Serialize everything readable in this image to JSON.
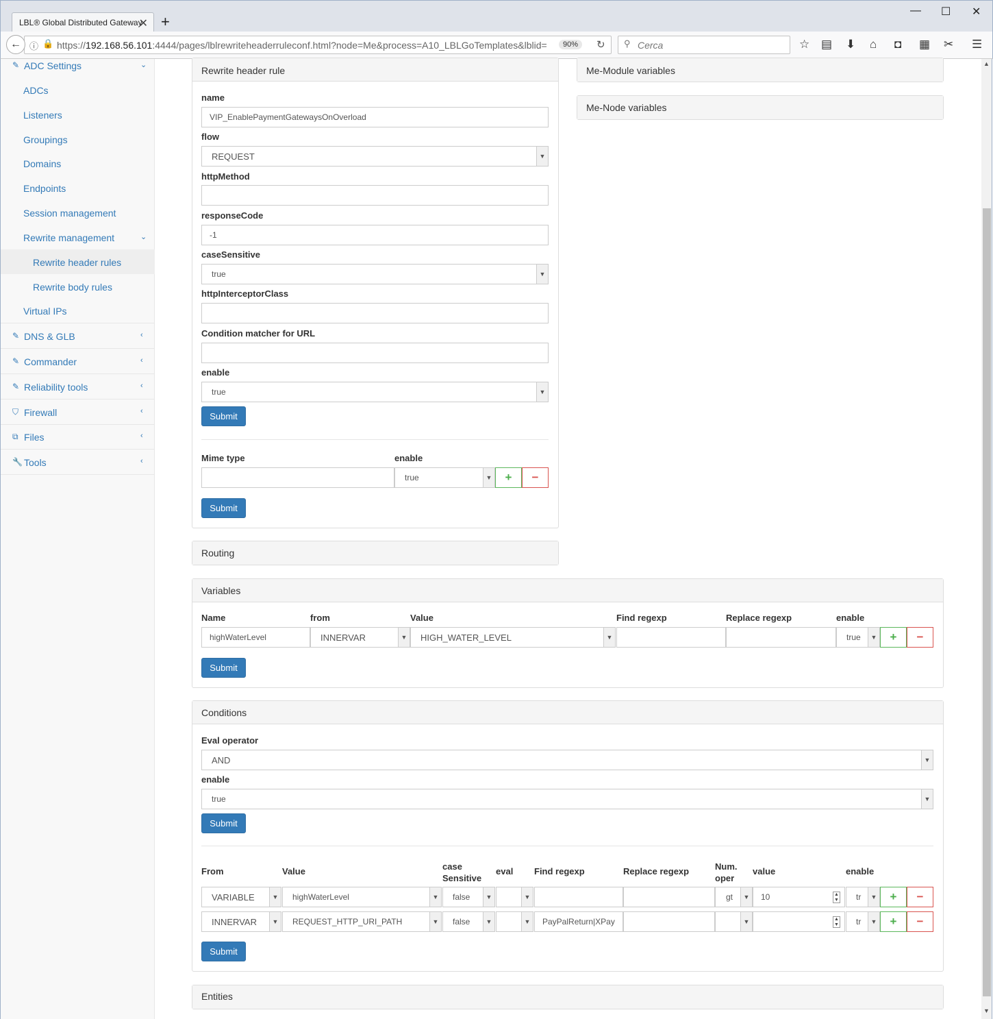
{
  "browser": {
    "tab_title": "LBL® Global Distributed Gateway",
    "url_prefix": "https://",
    "url_host": "192.168.56.101",
    "url_rest": ":4444/pages/lblrewriteheaderruleconf.html?node=Me&process=A10_LBLGoTemplates&lblid=",
    "zoom": "90%",
    "search_placeholder": "Cerca"
  },
  "sidebar": {
    "adc_settings": "ADC Settings",
    "items": [
      "ADCs",
      "Listeners",
      "Groupings",
      "Domains",
      "Endpoints",
      "Session management",
      "Rewrite management"
    ],
    "sub_items": [
      "Rewrite header rules",
      "Rewrite body rules"
    ],
    "virtual_ips": "Virtual IPs",
    "groups": [
      "DNS & GLB",
      "Commander",
      "Reliability tools",
      "Firewall",
      "Files",
      "Tools"
    ]
  },
  "rewrite_panel": {
    "title": "Rewrite header rule",
    "fields": {
      "name_label": "name",
      "name_value": "VIP_EnablePaymentGatewaysOnOverload",
      "flow_label": "flow",
      "flow_value": "REQUEST",
      "httpMethod_label": "httpMethod",
      "httpMethod_value": "",
      "responseCode_label": "responseCode",
      "responseCode_value": "-1",
      "caseSensitive_label": "caseSensitive",
      "caseSensitive_value": "true",
      "httpInterceptorClass_label": "httpInterceptorClass",
      "httpInterceptorClass_value": "",
      "condition_url_label": "Condition matcher for URL",
      "condition_url_value": "",
      "enable_label": "enable",
      "enable_value": "true"
    },
    "submit": "Submit",
    "mime": {
      "mime_label": "Mime type",
      "enable_label": "enable",
      "mime_value": "",
      "enable_value": "true",
      "plus": "+",
      "minus": "−",
      "submit": "Submit"
    }
  },
  "right_panels": [
    "Me-Module variables",
    "Me-Node variables"
  ],
  "routing": {
    "title": "Routing"
  },
  "variables": {
    "title": "Variables",
    "headers": [
      "Name",
      "from",
      "Value",
      "Find regexp",
      "Replace regexp",
      "enable"
    ],
    "row": {
      "name": "highWaterLevel",
      "from": "INNERVAR",
      "value": "HIGH_WATER_LEVEL",
      "find": "",
      "replace": "",
      "enable": "true"
    },
    "submit": "Submit"
  },
  "conditions": {
    "title": "Conditions",
    "eval_label": "Eval operator",
    "eval_value": "AND",
    "enable_label": "enable",
    "enable_value": "true",
    "submit": "Submit",
    "headers": [
      "From",
      "Value",
      "case\nSensitive",
      "eval",
      "Find regexp",
      "Replace regexp",
      "Num.\noper",
      "value",
      "enable"
    ],
    "rows": [
      {
        "from": "VARIABLE",
        "value": "highWaterLevel",
        "case": "false",
        "eval": "",
        "find": "",
        "replace": "",
        "oper": "gt",
        "val": "10",
        "enable": "tr"
      },
      {
        "from": "INNERVAR",
        "value": "REQUEST_HTTP_URI_PATH",
        "case": "false",
        "eval": "",
        "find": "PayPalReturn|XPay",
        "replace": "",
        "oper": "",
        "val": "",
        "enable": "tr"
      }
    ],
    "submit2": "Submit"
  },
  "entities": {
    "title": "Entities"
  }
}
